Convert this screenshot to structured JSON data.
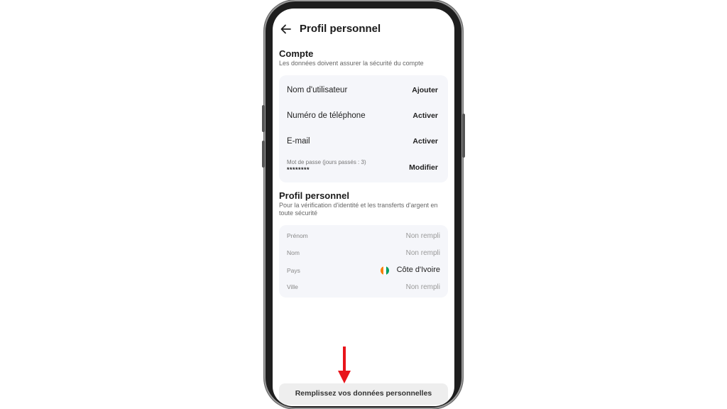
{
  "header": {
    "title": "Profil personnel",
    "back_icon": "arrow-left-icon"
  },
  "account": {
    "title": "Compte",
    "subtitle": "Les données doivent assurer la sécurité du compte",
    "rows": [
      {
        "label": "Nom d'utilisateur",
        "action": "Ajouter"
      },
      {
        "label": "Numéro de téléphone",
        "action": "Activer"
      },
      {
        "label": "E-mail",
        "action": "Activer"
      }
    ],
    "password": {
      "label": "Mot de passe (jours passés : 3)",
      "value": "********",
      "action": "Modifier"
    }
  },
  "profile": {
    "title": "Profil personnel",
    "subtitle": "Pour la vérification d'identité et les transferts d'argent en toute sécurité",
    "fields": [
      {
        "label": "Prénom",
        "value": "Non rempli"
      },
      {
        "label": "Nom",
        "value": "Non rempli"
      },
      {
        "label": "Pays",
        "value": "Côte d'Ivoire",
        "flag_colors": [
          "#F77F00",
          "#FFFFFF",
          "#009E60"
        ]
      },
      {
        "label": "Ville",
        "value": "Non rempli"
      }
    ]
  },
  "bottom_button": {
    "label": "Remplissez vos données personnelles"
  },
  "annotation": {
    "arrow_color": "#E8141B",
    "icon": "arrow-down-icon"
  }
}
